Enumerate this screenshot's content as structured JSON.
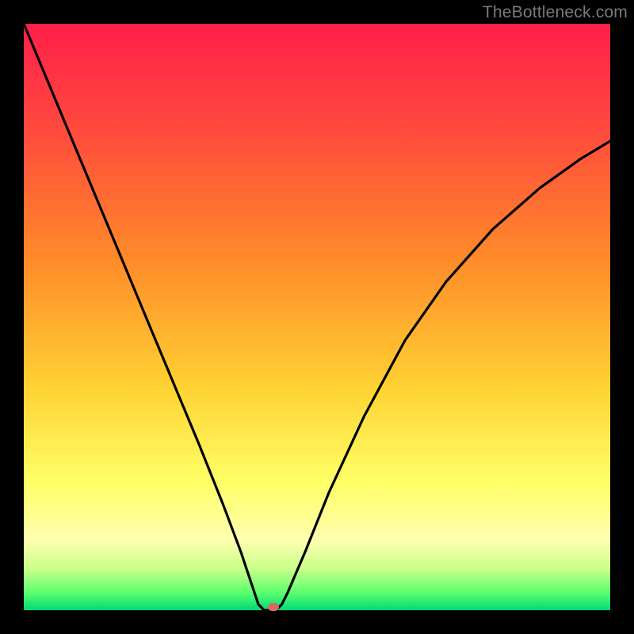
{
  "watermark": "TheBottleneck.com",
  "chart_data": {
    "type": "line",
    "title": "",
    "xlabel": "",
    "ylabel": "",
    "xlim": [
      0,
      100
    ],
    "ylim": [
      0,
      100
    ],
    "grid": false,
    "series": [
      {
        "name": "bottleneck-curve",
        "x": [
          0,
          5,
          10,
          15,
          20,
          25,
          30,
          34,
          37,
          39,
          40,
          41,
          42,
          43,
          44,
          45,
          48,
          52,
          58,
          65,
          72,
          80,
          88,
          95,
          100
        ],
        "values": [
          100,
          88,
          76,
          64,
          52,
          40,
          28,
          18,
          10,
          4,
          1,
          0,
          0,
          0,
          1,
          3,
          10,
          20,
          33,
          46,
          56,
          65,
          72,
          77,
          80
        ]
      }
    ],
    "marker": {
      "x_pct": 42.5,
      "y_pct": 0.5
    },
    "gradient_stops": [
      {
        "pos": 0,
        "color": "#ff1f4a"
      },
      {
        "pos": 18,
        "color": "#ff4a3d"
      },
      {
        "pos": 40,
        "color": "#ff8a2a"
      },
      {
        "pos": 62,
        "color": "#ffd233"
      },
      {
        "pos": 78,
        "color": "#ffff66"
      },
      {
        "pos": 88,
        "color": "#ffffb0"
      },
      {
        "pos": 93,
        "color": "#c9ff8a"
      },
      {
        "pos": 97,
        "color": "#5cff6e"
      },
      {
        "pos": 100,
        "color": "#00d976"
      }
    ]
  }
}
